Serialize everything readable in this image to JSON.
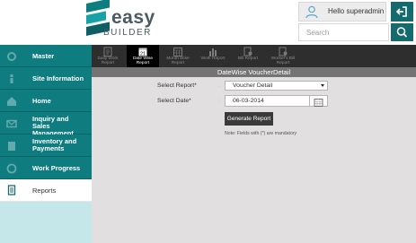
{
  "brand": {
    "word": "easy",
    "sub": "BUILDER"
  },
  "header": {
    "user_greeting": "Hello superadmin",
    "search_placeholder": "Search",
    "accent_color": "#156a6e"
  },
  "sidebar": {
    "items": [
      {
        "label": "Master",
        "icon": "gear-icon"
      },
      {
        "label": "Site Information",
        "icon": "info-icon"
      },
      {
        "label": "Home",
        "icon": "home-icon"
      },
      {
        "label": "Inquiry and Sales Management",
        "icon": "envelope-icon"
      },
      {
        "label": "Inventory and Payments",
        "icon": "building-icon"
      },
      {
        "label": "Work Progress",
        "icon": "progress-icon"
      },
      {
        "label": "Reports",
        "icon": "report-icon",
        "active": true
      }
    ]
  },
  "toolbar": {
    "items": [
      {
        "label": "Daily Work Report",
        "icon": "clipboard-icon"
      },
      {
        "label": "Date Wise Report",
        "icon": "calendar-icon",
        "active": true
      },
      {
        "label": "Month Wise Report",
        "icon": "calendar-grid-icon"
      },
      {
        "label": "Work Report",
        "icon": "bar-chart-icon"
      },
      {
        "label": "Bill Report",
        "icon": "bill-icon"
      },
      {
        "label": "Worker's Bill Report",
        "icon": "worker-bill-icon"
      }
    ]
  },
  "form": {
    "title": "DateWise VoucherDetail",
    "report_label": "Select Report*",
    "report_value": "Voucher Detail",
    "date_label": "Select Date*",
    "date_value": "06-03-2014",
    "colon": ":",
    "generate_label": "Generate Report",
    "note": "Note: Fields with (*) are mandatory"
  }
}
